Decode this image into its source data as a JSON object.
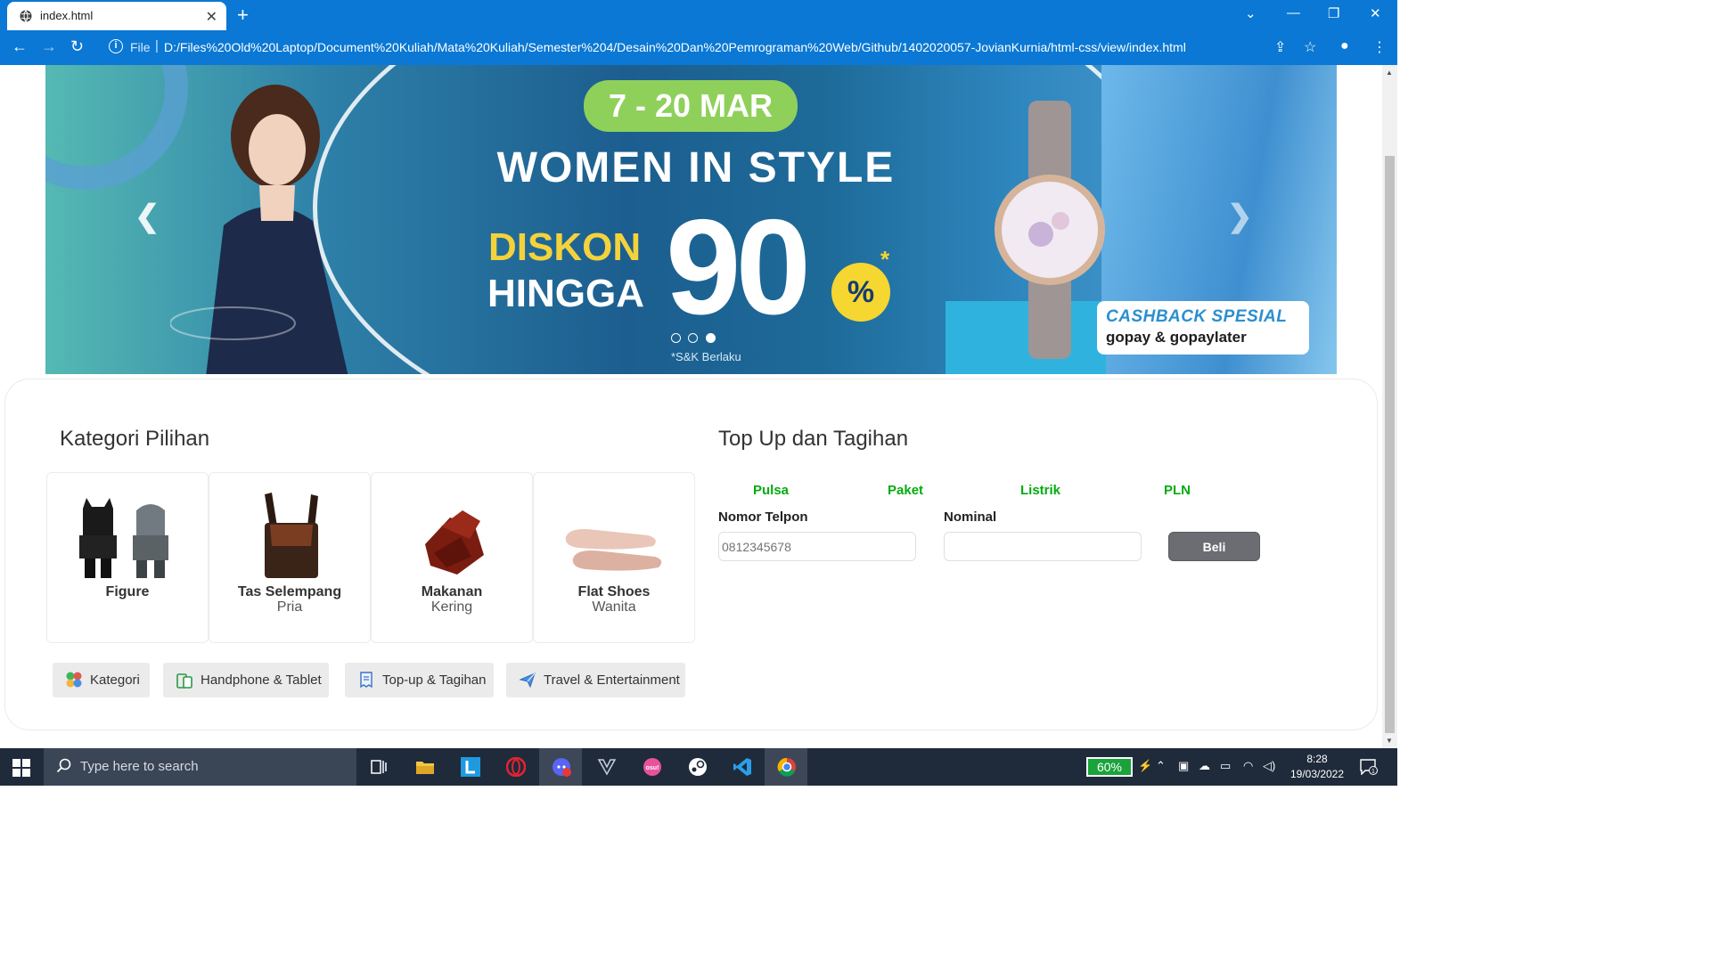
{
  "browser": {
    "tab_title": "index.html",
    "new_tab": "+",
    "tab_close": "✕",
    "file_label": "File",
    "url": "D:/Files%20Old%20Laptop/Document%20Kuliah/Mata%20Kuliah/Semester%204/Desain%20Dan%20Pemrograman%20Web/Github/1402020057-JovianKurnia/html-css/view/index.html"
  },
  "banner": {
    "date": "7 - 20 MAR",
    "headline": "WOMEN IN STYLE",
    "diskon": "DISKON",
    "hingga": "HINGGA",
    "big_number": "90",
    "percent": "%",
    "asterisk": "*",
    "terms": "*S&K Berlaku",
    "cashback_line1": "CASHBACK SPESIAL",
    "cashback_line2": "gopay & gopaylater",
    "slide_count": 3,
    "active_slide": 3
  },
  "kategori": {
    "title": "Kategori Pilihan",
    "cards": [
      {
        "name": "Figure",
        "sub": ""
      },
      {
        "name": "Tas Selempang",
        "sub": "Pria"
      },
      {
        "name": "Makanan",
        "sub": "Kering"
      },
      {
        "name": "Flat Shoes",
        "sub": "Wanita"
      }
    ],
    "chips": [
      {
        "label": "Kategori",
        "icon": "clover-icon"
      },
      {
        "label": "Handphone & Tablet",
        "icon": "tablet-icon"
      },
      {
        "label": "Top-up & Tagihan",
        "icon": "receipt-icon"
      },
      {
        "label": "Travel & Entertainment",
        "icon": "plane-icon"
      }
    ]
  },
  "topup": {
    "title": "Top Up dan Tagihan",
    "tabs": [
      "Pulsa",
      "Paket",
      "Listrik",
      "PLN"
    ],
    "phone_label": "Nomor Telpon",
    "phone_placeholder": "0812345678",
    "nominal_label": "Nominal",
    "nominal_value": "",
    "buy_button": "Beli",
    "accent_color": "#03ac0e"
  },
  "taskbar": {
    "search_placeholder": "Type here to search",
    "battery": "60%",
    "time": "8:28",
    "date": "19/03/2022",
    "notification_count": "1"
  }
}
